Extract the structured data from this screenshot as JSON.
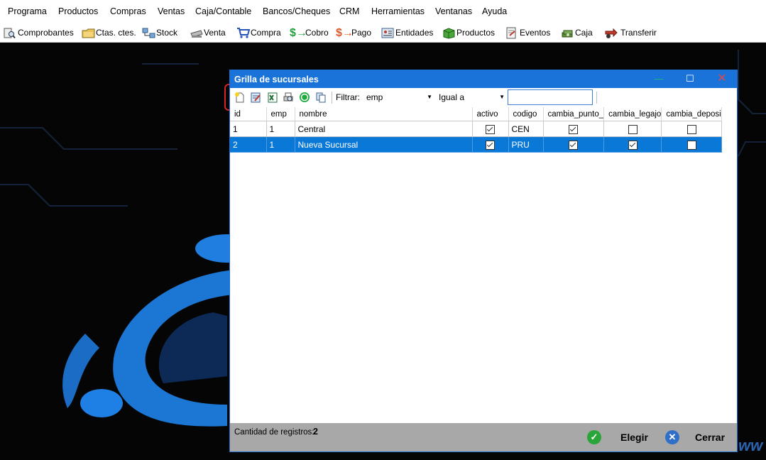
{
  "menu": [
    "Programa",
    "Productos",
    "Compras",
    "Ventas",
    "Caja/Contable",
    "Bancos/Cheques",
    "CRM",
    "Herramientas",
    "Ventanas",
    "Ayuda"
  ],
  "toolbar": {
    "comprobantes": "Comprobantes",
    "ctas": "Ctas. ctes.",
    "stock": "Stock",
    "venta": "Venta",
    "compra": "Compra",
    "cobro": "Cobro",
    "pago": "Pago",
    "entidades": "Entidades",
    "productos": "Productos",
    "eventos": "Eventos",
    "caja": "Caja",
    "transferir": "Transferir"
  },
  "window": {
    "title": "Grilla de sucursales",
    "filter_label": "Filtrar:",
    "filter_field": "emp",
    "filter_op": "Igual a",
    "search_value": ""
  },
  "grid": {
    "columns": [
      "id",
      "emp",
      "nombre",
      "activo",
      "codigo",
      "cambia_punto_",
      "cambia_legajo",
      "cambia_deposi"
    ],
    "rows": [
      {
        "id": "1",
        "emp": "1",
        "nombre": "Central",
        "activo": true,
        "codigo": "CEN",
        "cambia_punto": true,
        "cambia_legajo": false,
        "cambia_deposito": false
      },
      {
        "id": "2",
        "emp": "1",
        "nombre": "Nueva Sucursal",
        "activo": true,
        "codigo": "PRU",
        "cambia_punto": true,
        "cambia_legajo": true,
        "cambia_deposito": false
      }
    ]
  },
  "footer": {
    "count_label": "Cantidad de registros:",
    "count": "2",
    "elegir": "Elegir",
    "cerrar": "Cerrar"
  },
  "colors": {
    "title_blue": "#1a73d9",
    "selection": "#0a78d7",
    "highlight_red": "#d9232a"
  }
}
